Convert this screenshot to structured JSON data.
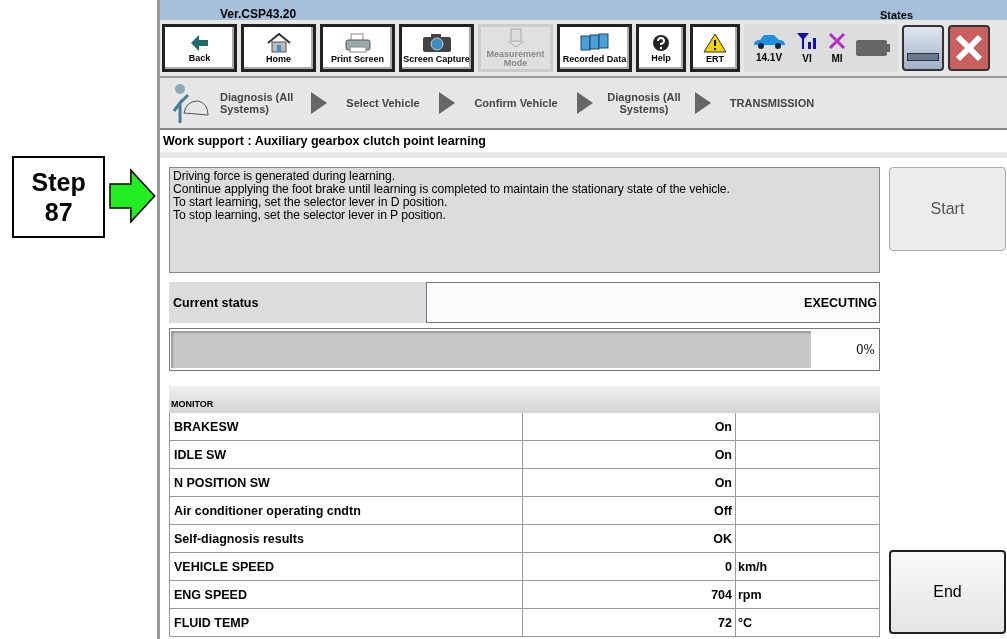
{
  "annotation": {
    "step_label": "Step",
    "step_number": "87"
  },
  "header": {
    "version": "Ver.CSP43.20",
    "states_label": "States"
  },
  "toolbar": [
    {
      "label": "Back",
      "kind": "back",
      "disabled": false
    },
    {
      "label": "Home",
      "kind": "home",
      "disabled": false
    },
    {
      "label": "Print Screen",
      "kind": "printer",
      "disabled": false
    },
    {
      "label": "Screen Capture",
      "kind": "camera",
      "disabled": false
    },
    {
      "label": "Measurement Mode",
      "kind": "meter",
      "disabled": true
    },
    {
      "label": "Recorded Data",
      "kind": "folders",
      "disabled": false
    },
    {
      "label": "Help",
      "kind": "help",
      "disabled": false
    },
    {
      "label": "ERT",
      "kind": "warning",
      "disabled": false
    }
  ],
  "states": [
    {
      "label": "14.1V",
      "kind": "car"
    },
    {
      "label": "VI",
      "kind": "signal"
    },
    {
      "label": "MI",
      "kind": "cross"
    },
    {
      "kind": "battery"
    }
  ],
  "breadcrumb": [
    "Diagnosis (All Systems)",
    "Select Vehicle",
    "Confirm Vehicle",
    "Diagnosis (All Systems)",
    "TRANSMISSION"
  ],
  "work_title": "Work support : Auxiliary gearbox clutch point learning",
  "message": [
    "Driving force is generated during learning.",
    "Continue applying the foot brake until learning is completed to maintain the stationary state of the vehicle.",
    "To start learning, set the selector lever in D position.",
    "To stop learning, set the selector lever in P position."
  ],
  "start_button": {
    "label": "Start",
    "disabled": true
  },
  "status": {
    "label": "Current status",
    "value": "EXECUTING"
  },
  "progress": {
    "level": 0,
    "reading": "0%"
  },
  "monitor": {
    "title": "MONITOR",
    "rows": [
      {
        "name": "BRAKESW",
        "value": "On"
      },
      {
        "name": "IDLE SW",
        "value": "On"
      },
      {
        "name": "N POSITION SW",
        "value": "On"
      },
      {
        "name": "Air conditioner operating cndtn",
        "value": "Off"
      },
      {
        "name": "Self-diagnosis results",
        "value": "OK"
      },
      {
        "name": "VEHICLE SPEED",
        "value": "0",
        "unit": "km/h"
      },
      {
        "name": "ENG SPEED",
        "value": "704",
        "unit": "rpm"
      },
      {
        "name": "FLUID TEMP",
        "value": "72",
        "unit": "°C"
      }
    ]
  },
  "end_button": {
    "label": "End"
  }
}
